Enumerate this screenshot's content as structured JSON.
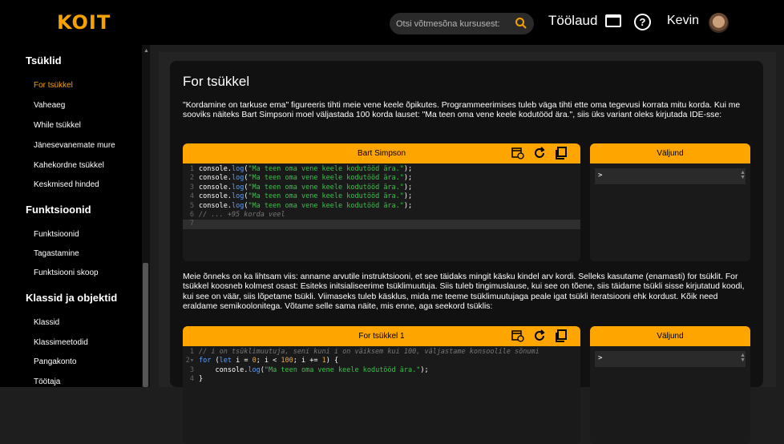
{
  "header": {
    "logo": "KOIT",
    "search_placeholder": "Otsi võtmesõna kursusest:",
    "dashboard_label": "Töölaud",
    "help_label": "?",
    "user_name": "Kevin"
  },
  "sidebar": {
    "sections": [
      {
        "title": "Tsüklid",
        "items": [
          "For tsükkel",
          "Vaheaeg",
          "While tsükkel",
          "Jänesevanemate mure",
          "Kahekordne tsükkel",
          "Keskmised hinded"
        ]
      },
      {
        "title": "Funktsioonid",
        "items": [
          "Funktsioonid",
          "Tagastamine",
          "Funktsiooni skoop"
        ]
      },
      {
        "title": "Klassid ja objektid",
        "items": [
          "Klassid",
          "Klassimeetodid",
          "Pangakonto",
          "Töötaja"
        ]
      }
    ],
    "active_item": "For tsükkel"
  },
  "content": {
    "title": "For tsükkel",
    "para1": "\"Kordamine on tarkuse ema\" figureeris tihti meie vene keele õpikutes. Programmeerimises tuleb väga tihti ette oma tegevusi korrata mitu korda. Kui me sooviks näiteks Bart Simpsoni moel väljastada 100 korda lauset: \"Ma teen oma vene keele kodutööd ära.\", siis üks variant oleks kirjutada IDE-sse:",
    "para2": "Meie õnneks on ka lihtsam viis: anname arvutile instruktsiooni, et see täidaks mingit käsku kindel arv kordi. Selleks kasutame (enamasti) for tsüklit. For tsükkel koosneb kolmest osast: Esiteks initsialiseerime tsüklimuutuja. Siis tuleb tingimuslause, kui see on tõene, siis täidame tsükli sisse kirjutatud koodi, kui see on väär, siis lõpetame tsükli. Viimaseks tuleb käsklus, mida me teeme tsüklimuutujaga peale igat tsükli iteratsiooni ehk kordust. Kõik need eraldame semikoolonitega. Võtame selle sama näite, mis enne, aga seekord tsüklis:",
    "editor1": {
      "title": "Bart Simpson",
      "output_title": "Väljund",
      "output_prompt": ">"
    },
    "editor2": {
      "title": "For tsükkel 1",
      "output_title": "Väljund",
      "output_prompt": ">"
    }
  },
  "colors": {
    "accent": "#ffa500",
    "background": "#1e1e1e"
  }
}
